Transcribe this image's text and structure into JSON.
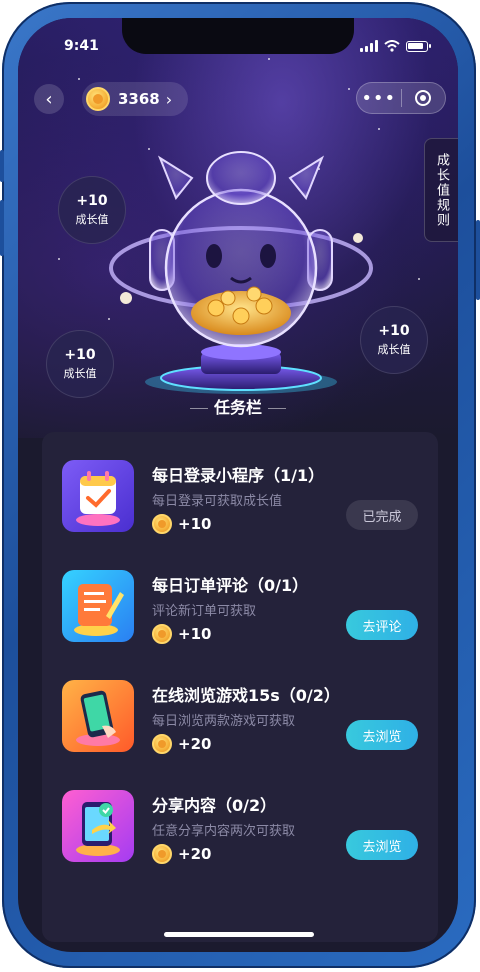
{
  "status_bar": {
    "time": "9:41"
  },
  "header": {
    "coin_count": "3368",
    "coin_chevron": "›",
    "back_glyph": "‹",
    "capsule_more": "•••"
  },
  "rules_tab": {
    "label": "成长值规则"
  },
  "growth_bubbles": [
    {
      "value": "+10",
      "label": "成长值"
    },
    {
      "value": "+10",
      "label": "成长值"
    },
    {
      "value": "+10",
      "label": "成长值"
    }
  ],
  "section": {
    "title": "任务栏"
  },
  "tasks": [
    {
      "title": "每日登录小程序（1/1）",
      "desc": "每日登录可获取成长值",
      "reward": "+10",
      "button": "已完成",
      "button_state": "done"
    },
    {
      "title": "每日订单评论（0/1）",
      "desc": "评论新订单可获取",
      "reward": "+10",
      "button": "去评论",
      "button_state": "active"
    },
    {
      "title": "在线浏览游戏15s（0/2）",
      "desc": "每日浏览两款游戏可获取",
      "reward": "+20",
      "button": "去浏览",
      "button_state": "active"
    },
    {
      "title": "分享内容（0/2）",
      "desc": "任意分享内容两次可获取",
      "reward": "+20",
      "button": "去浏览",
      "button_state": "active"
    }
  ],
  "colors": {
    "accent_button": "#38c9dd",
    "card_bg": "#24223a",
    "screen_bg": "#1b1a2e",
    "frame": "#1d4f9c"
  },
  "icons": [
    "back-icon",
    "coin-icon",
    "more-icon",
    "close-mini-icon",
    "calendar-check-icon",
    "review-pen-icon",
    "phone-browse-icon",
    "share-icon",
    "robot-mascot"
  ]
}
